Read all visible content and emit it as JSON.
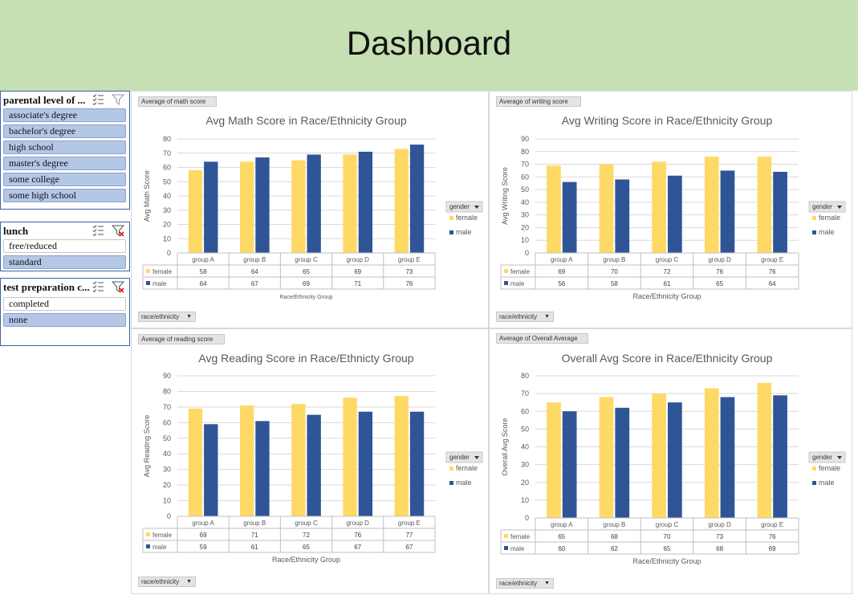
{
  "header": {
    "title": "Dashboard"
  },
  "colors": {
    "female": "#ffd966",
    "male": "#2f5597",
    "banner": "#c6e0b4",
    "slicer_selected": "#b4c7e7"
  },
  "slicers": {
    "parental": {
      "title": "parental level of ...",
      "items": [
        {
          "label": "associate's degree",
          "selected": true
        },
        {
          "label": "bachelor's degree",
          "selected": true
        },
        {
          "label": "high school",
          "selected": true
        },
        {
          "label": "master's degree",
          "selected": true
        },
        {
          "label": "some college",
          "selected": true
        },
        {
          "label": "some high school",
          "selected": true
        }
      ]
    },
    "lunch": {
      "title": "lunch",
      "items": [
        {
          "label": "free/reduced",
          "selected": false
        },
        {
          "label": "standard",
          "selected": true
        }
      ]
    },
    "prep": {
      "title": "test preparation c...",
      "items": [
        {
          "label": "completed",
          "selected": false
        },
        {
          "label": "none",
          "selected": true
        }
      ]
    }
  },
  "chart_data": [
    {
      "type": "bar",
      "field_button": "Average of math score",
      "title": "Avg Math Score in Race/Ethnicity Group",
      "xlabel": "Race/Ethnicity Group",
      "ylabel": "Avg Math Score",
      "ylim": [
        0,
        80
      ],
      "yticks": [
        0,
        10,
        20,
        30,
        40,
        50,
        60,
        70,
        80
      ],
      "categories": [
        "group A",
        "group B",
        "group C",
        "group D",
        "group E"
      ],
      "series": [
        {
          "name": "female",
          "values": [
            58,
            64,
            65,
            69,
            73
          ]
        },
        {
          "name": "male",
          "values": [
            64,
            67,
            69,
            71,
            76
          ]
        }
      ],
      "legend_title": "gender",
      "axis_button": "race/ethnicity"
    },
    {
      "type": "bar",
      "field_button": "Average of writing score",
      "title": "Avg Writing Score in Race/Ethnicity Group",
      "xlabel": "Race/Ethnicity Group",
      "ylabel": "Avg Writing Score",
      "ylim": [
        0,
        90
      ],
      "yticks": [
        0,
        10,
        20,
        30,
        40,
        50,
        60,
        70,
        80,
        90
      ],
      "categories": [
        "group A",
        "group B",
        "group C",
        "group D",
        "group E"
      ],
      "series": [
        {
          "name": "female",
          "values": [
            69,
            70,
            72,
            76,
            76
          ]
        },
        {
          "name": "male",
          "values": [
            56,
            58,
            61,
            65,
            64
          ]
        }
      ],
      "legend_title": "gender",
      "axis_button": "race/ethnicity"
    },
    {
      "type": "bar",
      "field_button": "Average of reading score",
      "title": "Avg Reading Score in Race/Ethnicty Group",
      "xlabel": "Race/Ethnicity Group",
      "ylabel": "Avg Reading Score",
      "ylim": [
        0,
        90
      ],
      "yticks": [
        0,
        10,
        20,
        30,
        40,
        50,
        60,
        70,
        80,
        90
      ],
      "categories": [
        "group A",
        "group B",
        "group C",
        "group D",
        "group E"
      ],
      "series": [
        {
          "name": "female",
          "values": [
            69,
            71,
            72,
            76,
            77
          ]
        },
        {
          "name": "male",
          "values": [
            59,
            61,
            65,
            67,
            67
          ]
        }
      ],
      "legend_title": "gender",
      "axis_button": "race/ethnicity"
    },
    {
      "type": "bar",
      "field_button": "Average of Overall Average",
      "title": "Overall Avg Score in Race/Ethnicity Group",
      "xlabel": "Race/Ethnicity Group",
      "ylabel": "Overall Avg Score",
      "ylim": [
        0,
        80
      ],
      "yticks": [
        0,
        10,
        20,
        30,
        40,
        50,
        60,
        70,
        80
      ],
      "categories": [
        "group A",
        "group B",
        "group C",
        "group D",
        "group E"
      ],
      "series": [
        {
          "name": "female",
          "values": [
            65,
            68,
            70,
            73,
            76
          ]
        },
        {
          "name": "male",
          "values": [
            60,
            62,
            65,
            68,
            69
          ]
        }
      ],
      "legend_title": "gender",
      "axis_button": "race/ethnicity"
    }
  ]
}
